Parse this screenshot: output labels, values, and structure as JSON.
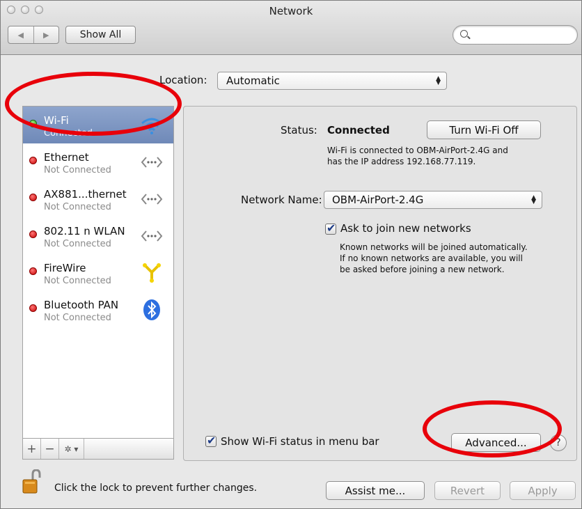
{
  "window": {
    "title": "Network"
  },
  "toolbar": {
    "back_glyph": "◀",
    "forward_glyph": "▶",
    "show_all_label": "Show All",
    "search_placeholder": ""
  },
  "location": {
    "label": "Location:",
    "value": "Automatic"
  },
  "services": [
    {
      "name": "Wi-Fi",
      "status": "Connected",
      "status_color": "green",
      "icon": "wifi-icon",
      "selected": true
    },
    {
      "name": "Ethernet",
      "status": "Not Connected",
      "status_color": "red",
      "icon": "ethernet-icon",
      "selected": false
    },
    {
      "name": "AX881...thernet",
      "status": "Not Connected",
      "status_color": "red",
      "icon": "ethernet-icon",
      "selected": false
    },
    {
      "name": "802.11 n WLAN",
      "status": "Not Connected",
      "status_color": "red",
      "icon": "ethernet-icon",
      "selected": false
    },
    {
      "name": "FireWire",
      "status": "Not Connected",
      "status_color": "red",
      "icon": "firewire-icon",
      "selected": false
    },
    {
      "name": "Bluetooth PAN",
      "status": "Not Connected",
      "status_color": "red",
      "icon": "bluetooth-icon",
      "selected": false
    }
  ],
  "sidebar_controls": {
    "add": "+",
    "remove": "−",
    "action": "✲ ▾"
  },
  "detail": {
    "status_label": "Status:",
    "status_value": "Connected",
    "toggle_button": "Turn Wi-Fi Off",
    "status_desc_line1": "Wi-Fi is connected to OBM-AirPort-2.4G and",
    "status_desc_line2": "has the IP address 192.168.77.119.",
    "network_name_label": "Network Name:",
    "network_name_value": "OBM-AirPort-2.4G",
    "ask_label": "Ask to join new networks",
    "ask_checked": true,
    "ask_desc_line1": "Known networks will be joined automatically.",
    "ask_desc_line2": "If no known networks are available, you will",
    "ask_desc_line3": "be asked before joining a new network.",
    "show_status_label": "Show Wi-Fi status in menu bar",
    "show_status_checked": true,
    "advanced_button": "Advanced...",
    "help_glyph": "?"
  },
  "footer": {
    "lock_text": "Click the lock to prevent further changes.",
    "assist_button": "Assist me...",
    "revert_button": "Revert",
    "apply_button": "Apply"
  },
  "colors": {
    "annotation": "#e8000a",
    "selection": "#7b93c2",
    "status_red": "#c40000",
    "status_green": "#2e9d18"
  }
}
